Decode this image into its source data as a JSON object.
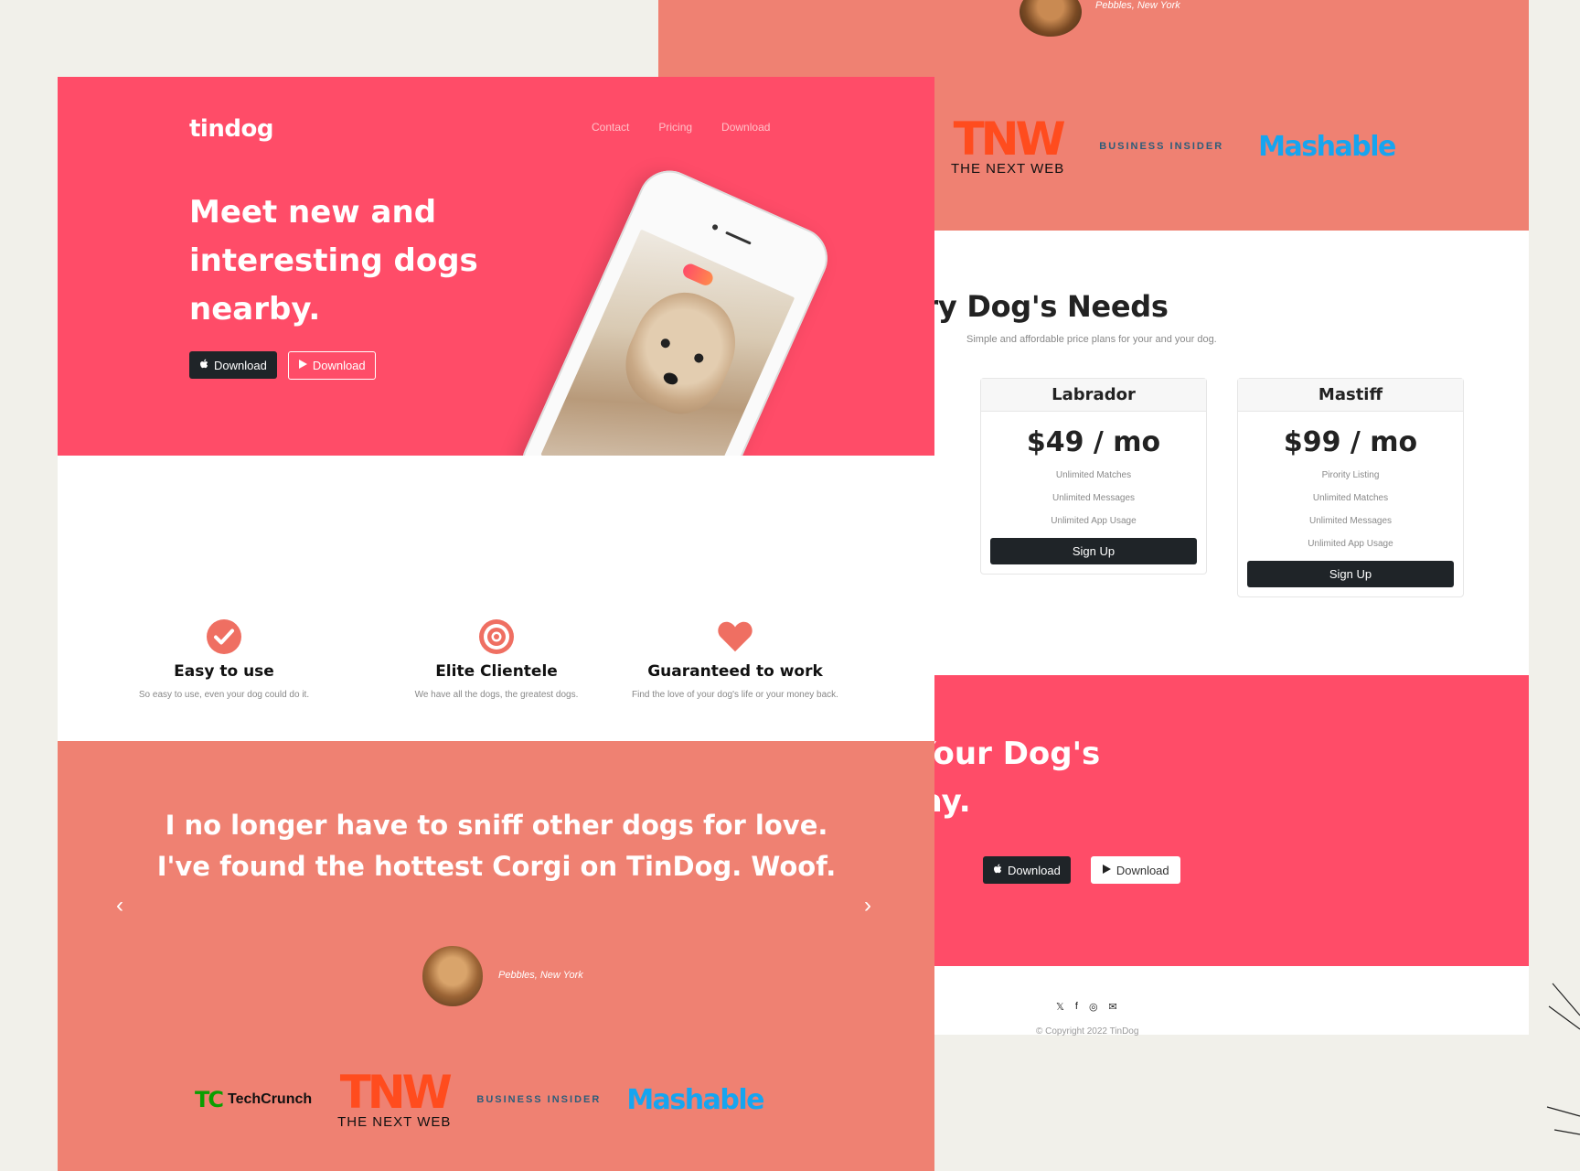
{
  "brand": "tindog",
  "nav": [
    "Contact",
    "Pricing",
    "Download"
  ],
  "hero": {
    "title": "Meet new and interesting dogs nearby.",
    "btn_apple": "Download",
    "btn_play": "Download"
  },
  "features": [
    {
      "title": "Easy to use",
      "desc": "So easy to use, even your dog could do it.",
      "icon": "check-circle-icon"
    },
    {
      "title": "Elite Clientele",
      "desc": "We have all the dogs, the greatest dogs.",
      "icon": "bullseye-icon"
    },
    {
      "title": "Guaranteed to work",
      "desc": "Find the love of your dog's life or your money back.",
      "icon": "heart-icon"
    }
  ],
  "testimonial": {
    "quote": "I no longer have to sniff other dogs for love. I've found the hottest Corgi on TinDog. Woof.",
    "author": "Pebbles, New York"
  },
  "press": {
    "techcrunch": "TechCrunch",
    "tnw_mark": "TNW",
    "tnw_text": "THE NEXT WEB",
    "business_insider": "BUSINESS INSIDER",
    "mashable": "Mashable"
  },
  "pricing": {
    "title": "lan for Every Dog's Needs",
    "subtitle": "Simple and affordable price plans for your and your dog.",
    "plans": [
      {
        "name": "Labrador",
        "price": "$49 / mo",
        "features": [
          "Unlimited Matches",
          "Unlimited Messages",
          "Unlimited App Usage"
        ],
        "button": "Sign Up"
      },
      {
        "name": "Mastiff",
        "price": "$99 / mo",
        "features": [
          "Pirority Listing",
          "Unlimited Matches",
          "Unlimited Messages",
          "Unlimited App Usage"
        ],
        "button": "Sign Up"
      }
    ]
  },
  "cta": {
    "title": "e True Love of Your Dog's Life Today.",
    "btn_apple": "Download",
    "btn_play": "Download"
  },
  "footer": {
    "copyright": "© Copyright 2022 TinDog"
  },
  "colors": {
    "hero_pink": "#ff4c68",
    "salmon": "#ef8172",
    "dark": "#1f2428",
    "bg": "#f1f0ea"
  }
}
